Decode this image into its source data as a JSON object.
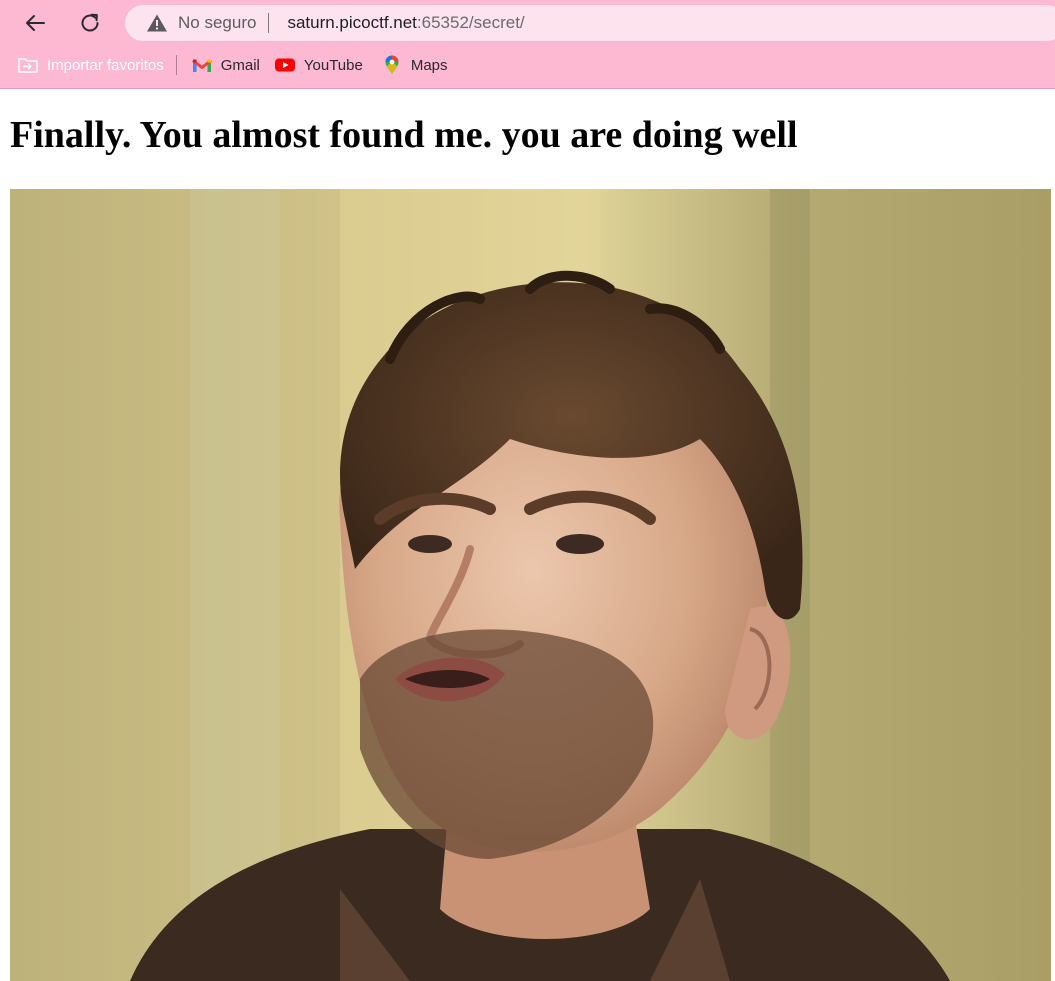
{
  "browser": {
    "omnibox": {
      "security_label": "No seguro",
      "url_host": "saturn.picoctf.net",
      "url_path": ":65352/secret/"
    },
    "bookmarks": [
      {
        "label": "Importar favoritos",
        "icon": "import-folder-icon"
      },
      {
        "label": "Gmail",
        "icon": "gmail-icon"
      },
      {
        "label": "YouTube",
        "icon": "youtube-icon"
      },
      {
        "label": "Maps",
        "icon": "maps-icon"
      }
    ],
    "colors": {
      "chrome_background": "#fdb8d2",
      "omnibox_background": "#fde3ee"
    }
  },
  "page": {
    "heading": "Finally. You almost found me. you are doing well",
    "image": {
      "kind": "animated gif",
      "subject": "man with curly brown hair and stubble, mid-speech"
    }
  }
}
